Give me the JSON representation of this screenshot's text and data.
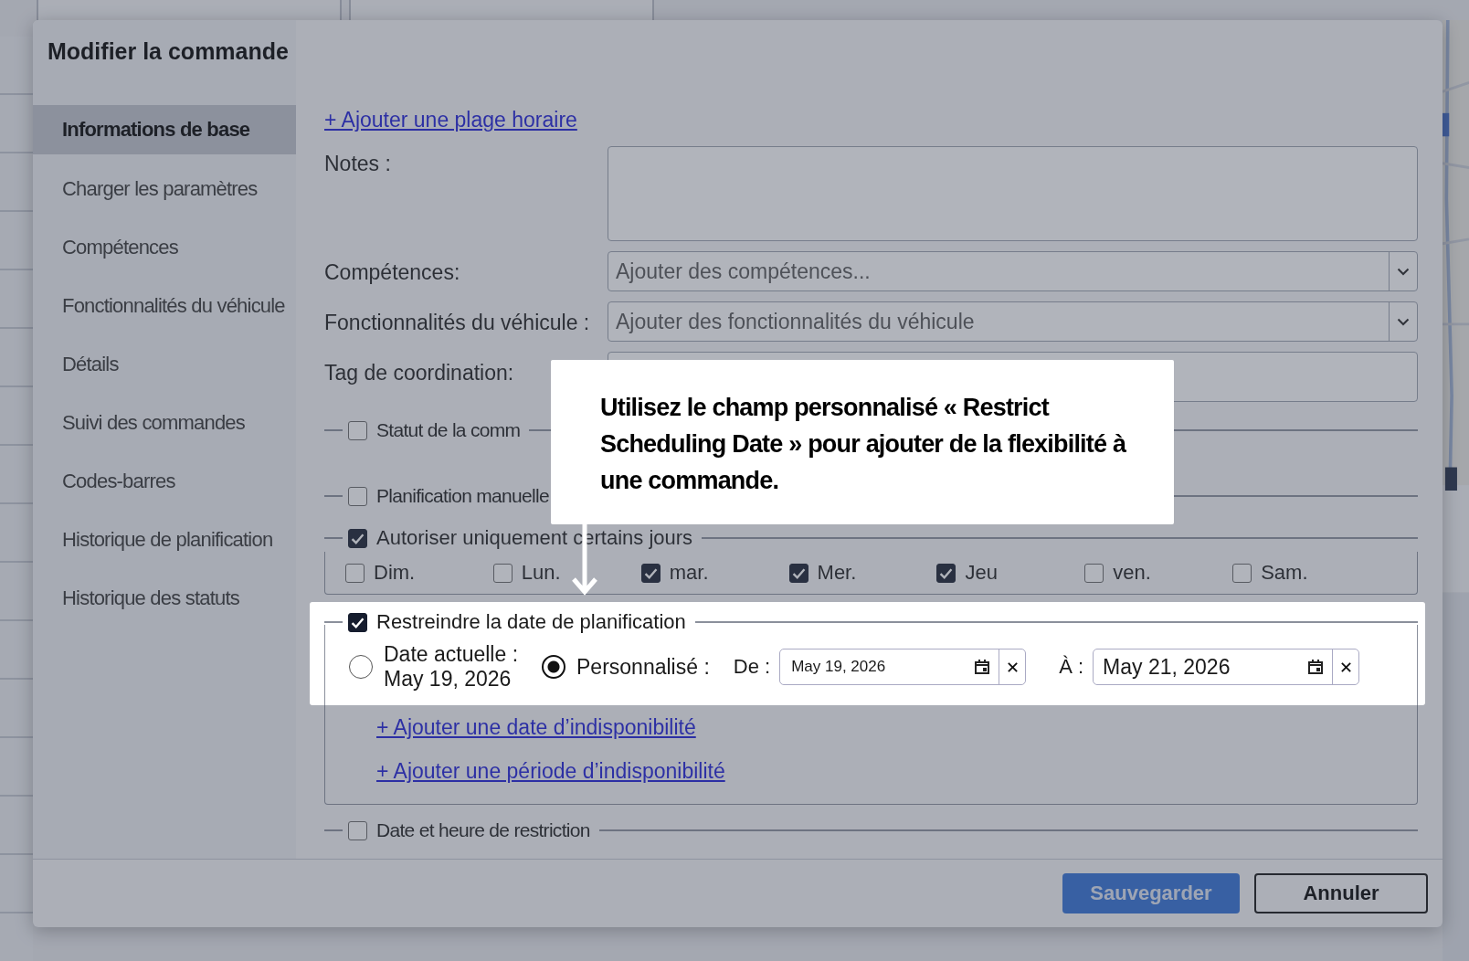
{
  "modal": {
    "title": "Modifier la commande"
  },
  "sidebar": {
    "items": [
      {
        "label": "Informations de base",
        "selected": true
      },
      {
        "label": "Charger les paramètres",
        "selected": false
      },
      {
        "label": "Compétences",
        "selected": false
      },
      {
        "label": "Fonctionnalités du véhicule",
        "selected": false
      },
      {
        "label": "Détails",
        "selected": false
      },
      {
        "label": "Suivi des commandes",
        "selected": false
      },
      {
        "label": "Codes-barres",
        "selected": false
      },
      {
        "label": "Historique de planification",
        "selected": false
      },
      {
        "label": "Historique des statuts",
        "selected": false
      }
    ]
  },
  "add_time_slot_link": "+ Ajouter une plage horaire",
  "fields": [
    {
      "kind": "textarea",
      "label": "Notes :"
    },
    {
      "kind": "select",
      "label": "Compétences:",
      "placeholder": "Ajouter des compétences..."
    },
    {
      "kind": "select",
      "label": "Fonctionnalités du véhicule :",
      "placeholder": "Ajouter des fonctionnalités du véhicule"
    },
    {
      "kind": "input",
      "label": "Tag de coordination:"
    }
  ],
  "sections": [
    {
      "kind": "collapsed",
      "label": "Statut de la comm",
      "checked": false
    },
    {
      "kind": "collapsed",
      "label": "Planification manuelle",
      "checked": false
    },
    {
      "kind": "days",
      "label": "Autoriser uniquement certains jours",
      "checked": true,
      "days": [
        {
          "label": "Dim.",
          "checked": false
        },
        {
          "label": "Lun.",
          "checked": false
        },
        {
          "label": "mar.",
          "checked": true
        },
        {
          "label": "Mer.",
          "checked": true
        },
        {
          "label": "Jeu",
          "checked": true
        },
        {
          "label": "ven.",
          "checked": false
        },
        {
          "label": "Sam.",
          "checked": false
        }
      ]
    },
    {
      "kind": "date_restriction",
      "label": "Restreindre la date de planification",
      "checked": true,
      "options": [
        {
          "label": "Date actuelle :",
          "value": "May 19, 2026",
          "selected": false
        },
        {
          "label": "Personnalisé :",
          "selected": true
        }
      ],
      "from": {
        "label": "De :",
        "value": "May 19, 2026"
      },
      "to": {
        "label": "À :",
        "value": "May 21, 2026"
      },
      "links": [
        "+ Ajouter une date d’indisponibilité",
        "+ Ajouter une période d’indisponibilité"
      ]
    },
    {
      "kind": "collapsed",
      "label": "Date et heure de restriction",
      "checked": false
    }
  ],
  "callout": {
    "text": "Utilisez le champ personnalisé « Restrict Scheduling Date » pour ajouter de la flexibilité à une commande."
  },
  "buttons": [
    {
      "label": "Sauvegarder",
      "kind": "primary"
    },
    {
      "label": "Annuler",
      "kind": "secondary"
    }
  ]
}
